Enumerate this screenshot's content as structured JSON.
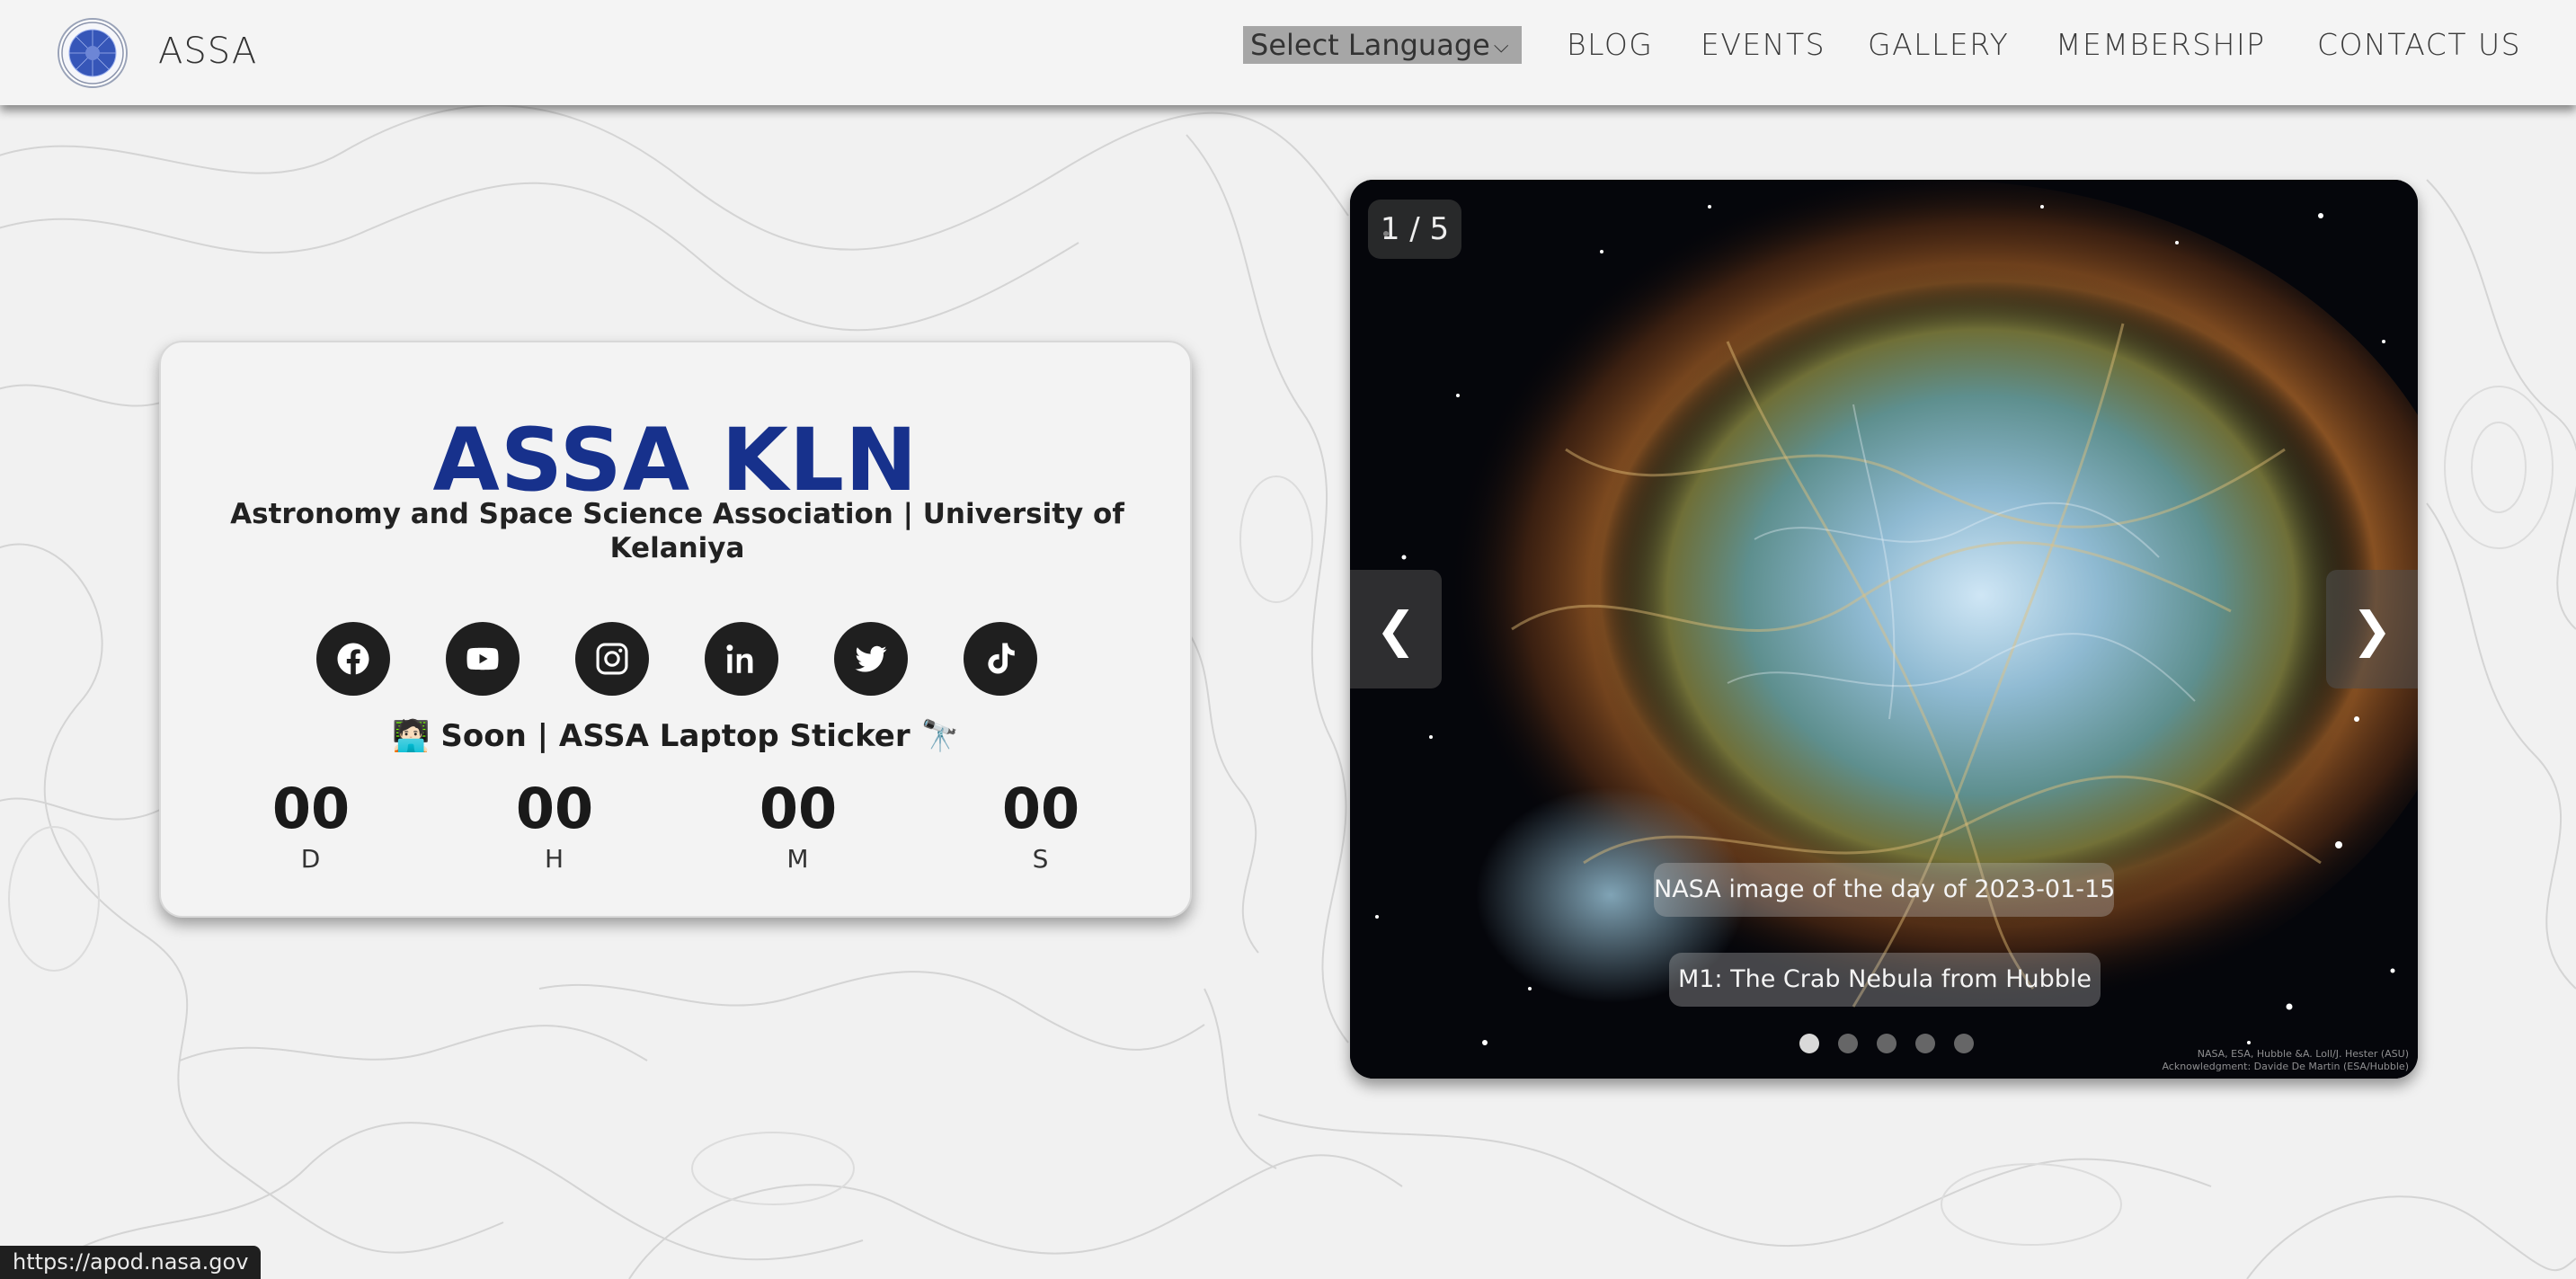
{
  "navbar": {
    "brand": "ASSA",
    "language_select": "Select Language",
    "links": [
      "BLOG",
      "EVENTS",
      "GALLERY",
      "MEMBERSHIP",
      "CONTACT US"
    ]
  },
  "card": {
    "title": "ASSA KLN",
    "subtitle": "Astronomy and Space Science Association | University of Kelaniya",
    "socials": [
      "facebook-icon",
      "youtube-icon",
      "instagram-icon",
      "linkedin-icon",
      "twitter-icon",
      "tiktok-icon"
    ],
    "announcement": "🧑🏻‍💻 Soon | ASSA Laptop Sticker 🔭",
    "countdown": [
      {
        "value": "00",
        "label": "D"
      },
      {
        "value": "00",
        "label": "H"
      },
      {
        "value": "00",
        "label": "M"
      },
      {
        "value": "00",
        "label": "S"
      }
    ]
  },
  "slideshow": {
    "counter": "1 / 5",
    "prev": "❮",
    "next": "❯",
    "caption_date": "NASA image of the day of 2023-01-15",
    "caption_title": "M1: The Crab Nebula from Hubble",
    "total_slides": 5,
    "active_slide": 1,
    "credit_line1": "NASA, ESA, Hubble &A. Loll/J. Hester (ASU)",
    "credit_line2": "Acknowledgment: Davide De Martin (ESA/Hubble)"
  },
  "status_bar": {
    "url": "https://apod.nasa.gov"
  }
}
